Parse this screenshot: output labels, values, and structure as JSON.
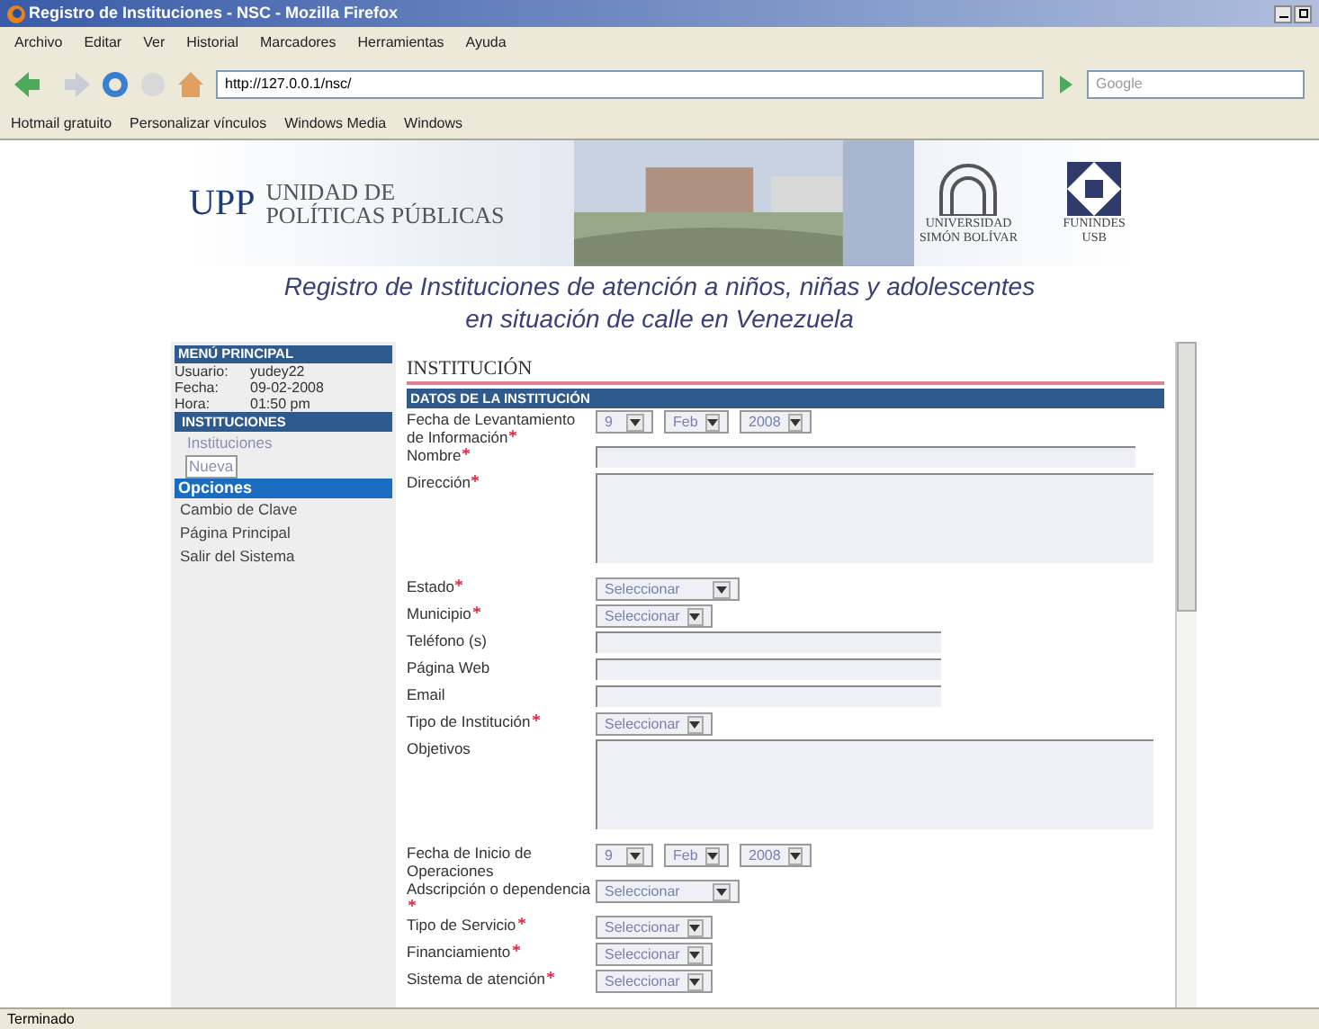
{
  "window": {
    "title": "Registro de Instituciones - NSC - Mozilla Firefox"
  },
  "menu": [
    "Archivo",
    "Editar",
    "Ver",
    "Historial",
    "Marcadores",
    "Herramientas",
    "Ayuda"
  ],
  "address": {
    "value": "http://127.0.0.1/nsc/"
  },
  "search": {
    "placeholder": "Google"
  },
  "bookmarks": [
    "Hotmail gratuito",
    "Personalizar vínculos",
    "Windows Media",
    "Windows"
  ],
  "header": {
    "logo_short": "UPP",
    "logo_line1": "UNIDAD DE",
    "logo_line2": "POLÍTICAS PÚBLICAS",
    "uni": "UNIVERSIDAD SIMÓN BOLÍVAR",
    "fund": "FUNINDES USB"
  },
  "page_title": [
    "Registro de Instituciones de atención a niños, niñas y adolescentes",
    "en situación de calle en Venezuela"
  ],
  "sidebar": {
    "title": "MENÚ PRINCIPAL",
    "info": [
      {
        "label": "Usuario:",
        "value": "yudey22"
      },
      {
        "label": "Fecha:",
        "value": "09-02-2008"
      },
      {
        "label": "Hora:",
        "value": "01:50 pm"
      }
    ],
    "sections": [
      {
        "title": "INSTITUCIONES",
        "kind": "dark",
        "items": [
          {
            "label": "Instituciones",
            "selected": false
          },
          {
            "label": "Nueva",
            "selected": true
          }
        ]
      },
      {
        "title": "Opciones",
        "kind": "bright",
        "items": [
          {
            "label": "Cambio de Clave",
            "selected": false
          },
          {
            "label": "Página Principal",
            "selected": false
          },
          {
            "label": "Salir del Sistema",
            "selected": false
          }
        ]
      }
    ]
  },
  "form": {
    "title": "INSTITUCIÓN",
    "section": "DATOS DE LA INSTITUCIÓN",
    "fields": [
      {
        "label": "Fecha de Levantamiento de Información",
        "required": true,
        "kind": "date",
        "day": "9",
        "month": "Feb",
        "year": "2008"
      },
      {
        "label": "Nombre",
        "required": true,
        "kind": "text",
        "wide": true
      },
      {
        "label": "Dirección",
        "required": true,
        "kind": "textarea"
      },
      {
        "label": "Estado",
        "required": true,
        "kind": "select",
        "value": "Seleccionar"
      },
      {
        "label": "Municipio",
        "required": true,
        "kind": "select",
        "value": "Seleccionar"
      },
      {
        "label": "Teléfono (s)",
        "required": false,
        "kind": "text",
        "wide": false
      },
      {
        "label": "Página Web",
        "required": false,
        "kind": "text",
        "wide": false
      },
      {
        "label": "Email",
        "required": false,
        "kind": "text",
        "wide": false
      },
      {
        "label": "Tipo de Institución",
        "required": true,
        "kind": "select",
        "value": "Seleccionar"
      },
      {
        "label": "Objetivos",
        "required": false,
        "kind": "textarea"
      },
      {
        "label": "Fecha de Inicio de Operaciones",
        "required": false,
        "kind": "date",
        "day": "9",
        "month": "Feb",
        "year": "2008"
      },
      {
        "label": "Adscripción o dependencia",
        "required": true,
        "kind": "select",
        "value": "Seleccionar"
      },
      {
        "label": "Tipo de Servicio",
        "required": true,
        "kind": "select",
        "value": "Seleccionar"
      },
      {
        "label": "Financiamiento",
        "required": true,
        "kind": "select",
        "value": "Seleccionar"
      },
      {
        "label": "Sistema de atención",
        "required": true,
        "kind": "select",
        "value": "Seleccionar"
      }
    ]
  },
  "status_bar": "Terminado"
}
